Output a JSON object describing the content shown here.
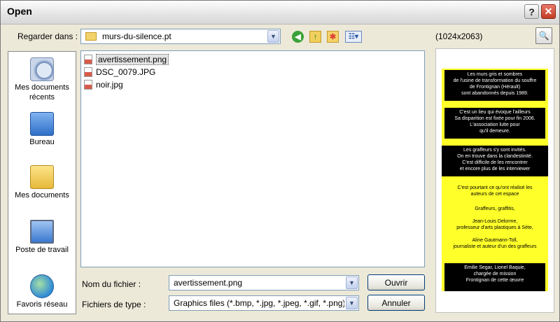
{
  "window": {
    "title": "Open",
    "help_label": "?",
    "close_label": "✕"
  },
  "toolbar": {
    "lookin_label": "Regarder dans :",
    "current_folder": "murs-du-silence.pt",
    "icons": [
      "back-icon",
      "up-folder-icon",
      "new-folder-icon",
      "views-menu-icon"
    ],
    "resolution": "(1024x2063)"
  },
  "places": [
    {
      "label": "Mes documents récents",
      "icon": "recent-documents-icon"
    },
    {
      "label": "Bureau",
      "icon": "desktop-icon"
    },
    {
      "label": "Mes documents",
      "icon": "my-documents-icon"
    },
    {
      "label": "Poste de travail",
      "icon": "my-computer-icon"
    },
    {
      "label": "Favoris réseau",
      "icon": "network-places-icon"
    }
  ],
  "files": [
    {
      "name": "avertissement.png",
      "selected": true
    },
    {
      "name": "DSC_0079.JPG",
      "selected": false
    },
    {
      "name": "noir.jpg",
      "selected": false
    }
  ],
  "filename": {
    "label": "Nom du fichier :",
    "value": "avertissement.png"
  },
  "filetype": {
    "label": "Fichiers de type :",
    "value": "Graphics files (*.bmp, *.jpg, *.jpeg, *.gif, *.png)"
  },
  "buttons": {
    "open": "Ouvrir",
    "cancel": "Annuler"
  },
  "preview": {
    "block1": "Les murs gris et sombres\nde l'usine de transformation du souffre\nde Frontignan (Hérault)\nsont abandonnés depuis 1989.",
    "block2": "C'est un lieu qui évoque l'ailleurs\nSa disparition est fixée pour fin 2006.\nL'association lutte pour\nqu'il demeure.",
    "block3": "Les graffeurs s'y sont invités.\nOn en trouve dans la clandestinité.\nC'est difficile de les rencontrer\net encore plus de les interviewer",
    "text1": "C'est pourtant ce qu'ont réalisé les\nauteurs de cet espace",
    "text2": "Graffeurs, graffitis,\n\nJean-Louis Delorme,\nprofesseur d'arts plastiques à Sète,\n\nAline Gautmann-Toll,\njournaliste et auteur d'un des graffeurs",
    "block4": "Emilie Segar, Lionel Baquie,\nchargée de mission\nFrontignan de cette œuvre"
  }
}
